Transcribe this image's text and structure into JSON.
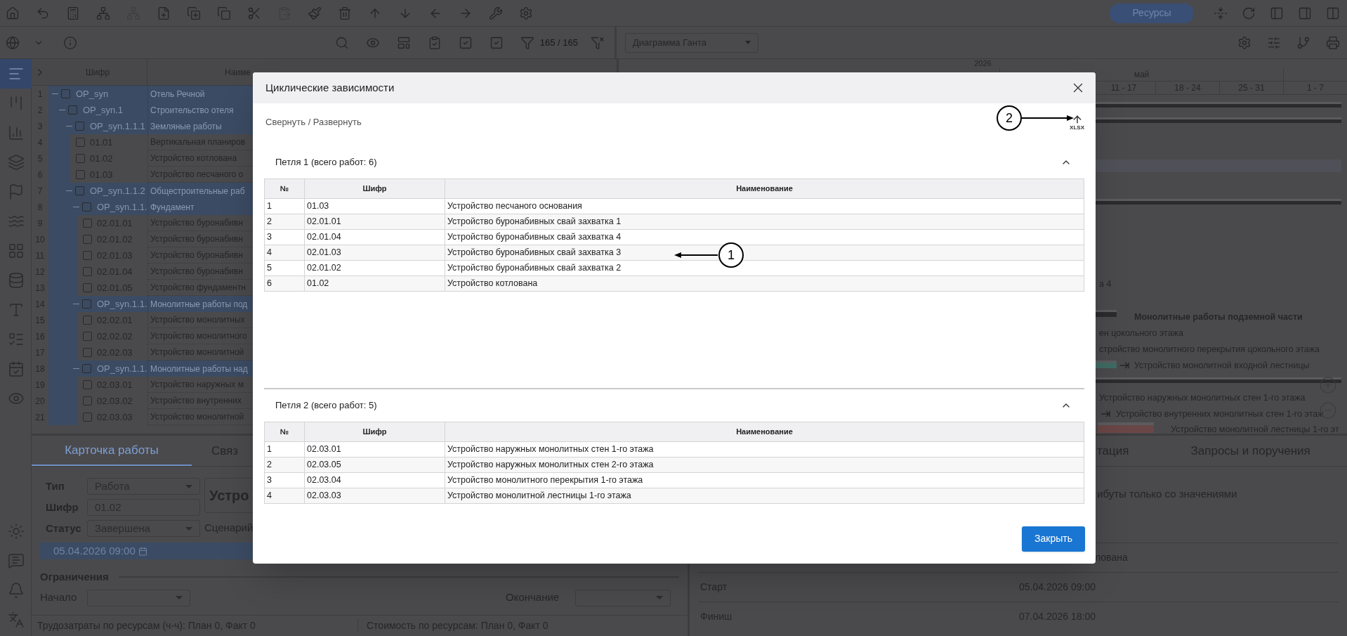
{
  "toolbar": {
    "resource_button": "Ресурсы",
    "filter_count": "165 / 165",
    "view_select": "Диаграмма Ганта"
  },
  "sidebar": {
    "items": [
      {
        "selected": true
      },
      {
        "selected": false
      },
      {
        "selected": false
      },
      {
        "selected": false
      },
      {
        "selected": false
      },
      {
        "selected": false
      },
      {
        "selected": false
      },
      {
        "selected": false
      },
      {
        "selected": false
      },
      {
        "selected": false
      },
      {
        "selected": false
      },
      {
        "selected": false
      },
      {
        "selected": false
      },
      {
        "selected": false
      },
      {
        "selected": false
      },
      {
        "selected": false
      }
    ]
  },
  "tree": {
    "columns": [
      "Шифр",
      "Наиме"
    ],
    "rows": [
      {
        "num": "1",
        "code": "OP_syn",
        "name": "Отель Речной",
        "checked": false,
        "expanded": true,
        "children": [
          {
            "num": "2",
            "code": "OP_syn.1",
            "name": "Строительство отеля",
            "checked": false,
            "expanded": true,
            "children": [
              {
                "num": "3",
                "code": "OP_syn.1.1.1",
                "name": "Земляные работы",
                "checked": false,
                "expanded": true,
                "children": [
                  {
                    "num": "4",
                    "code": "01.01",
                    "name": "Вертикальная планиров",
                    "checked": false
                  },
                  {
                    "num": "5",
                    "code": "01.02",
                    "name": "Устройство котлована",
                    "checked": false
                  },
                  {
                    "num": "6",
                    "code": "01.03",
                    "name": "Устройство песчаного о",
                    "checked": false
                  }
                ]
              },
              {
                "num": "7",
                "code": "OP_syn.1.1.2",
                "name": "Общестроительные раб",
                "checked": false,
                "expanded": true,
                "children": [
                  {
                    "num": "8",
                    "code": "OP_syn.1.1.",
                    "name": "Фундамент",
                    "checked": false,
                    "expanded": true,
                    "children": [
                      {
                        "num": "9",
                        "code": "02.01.01",
                        "name": "Устройство буронабивн",
                        "checked": false
                      },
                      {
                        "num": "10",
                        "code": "02.01.02",
                        "name": "Устройство буронабивн",
                        "checked": false
                      },
                      {
                        "num": "11",
                        "code": "02.01.03",
                        "name": "Устройство буронабивн",
                        "checked": false
                      },
                      {
                        "num": "12",
                        "code": "02.01.04",
                        "name": "Устройство буронабивн",
                        "checked": false
                      },
                      {
                        "num": "13",
                        "code": "02.01.05",
                        "name": "Устройство фундаментн",
                        "checked": false
                      }
                    ]
                  },
                  {
                    "num": "14",
                    "code": "OP_syn.1.1.",
                    "name": "Монолитные работы под",
                    "checked": false,
                    "expanded": true,
                    "children": [
                      {
                        "num": "15",
                        "code": "02.02.01",
                        "name": "Устройство монолитных",
                        "checked": false
                      },
                      {
                        "num": "16",
                        "code": "02.02.02",
                        "name": "Устройство монолитного",
                        "checked": false
                      },
                      {
                        "num": "17",
                        "code": "02.02.03",
                        "name": "Устройство монолитной",
                        "checked": false
                      }
                    ]
                  },
                  {
                    "num": "18",
                    "code": "OP_syn.1.1.",
                    "name": "Монолитные работы над",
                    "checked": false,
                    "expanded": true,
                    "children": [
                      {
                        "num": "19",
                        "code": "02.03.01",
                        "name": "Устройство наружных м",
                        "checked": false
                      },
                      {
                        "num": "20",
                        "code": "02.03.02",
                        "name": "Устройство внутренних",
                        "checked": false
                      },
                      {
                        "num": "21",
                        "code": "02.03.03",
                        "name": "Устройство монолитной",
                        "checked": false
                      }
                    ]
                  }
                ]
              }
            ]
          }
        ]
      }
    ]
  },
  "work_card": {
    "tabs": [
      {
        "label": "Карточка работы",
        "selected": true
      },
      {
        "label": "Связ",
        "selected": false
      }
    ],
    "fields": [
      {
        "label": "Тип",
        "value": "Работа",
        "kind": "select"
      },
      {
        "label": "Шифр",
        "value": "01.02",
        "kind": "text"
      },
      {
        "label": "Статус",
        "value": "Завершена",
        "kind": "select"
      }
    ],
    "title": "Устро",
    "scenario_label": "Сценарий",
    "date": "05.04.2026 09:00",
    "constraints_title": "Ограничения",
    "start_label": "Начало",
    "end_label": "Окончание",
    "labor": "Трудозатраты по ресурсам (ч-ч): План 0, Факт 0",
    "cost": "Стоимость по ресурсам: План 0, Факт 0"
  },
  "gantt": {
    "year": "2026",
    "month": "май",
    "weeks": [
      "11 - 17",
      "18 - 24",
      "25 - 31",
      "1 - 7"
    ],
    "items": [
      {
        "text": "а 4",
        "kind": "label"
      },
      {
        "text": "Монолитные работы подземной части",
        "kind": "summary"
      },
      {
        "text": "ен цокольного этажа",
        "kind": "label"
      },
      {
        "text": "стройство монолитного перекрытия цокольного этажа",
        "kind": "label"
      },
      {
        "text": "Устройство монолитной входной лестницы",
        "kind": "label"
      },
      {
        "text": "Устройство наружных монолитных стен 1-го этажа",
        "kind": "label"
      },
      {
        "text": "Устройство внутренних монолитных стен 1-го этаж",
        "kind": "label"
      },
      {
        "text": "Устройство монолитной лестницы 1-го эт",
        "kind": "label"
      }
    ]
  },
  "details": {
    "tabs": [
      {
        "label": "тация",
        "selected": false
      },
      {
        "label": "Запросы и поручения",
        "selected": false
      }
    ],
    "filter_text": "ибуты только со значениями",
    "rows": [
      {
        "value": "лована"
      },
      {
        "label": "Старт",
        "value": "05.04.2026 09:00"
      },
      {
        "label": "Финиш",
        "value": "07.04.2026 18:00"
      }
    ]
  },
  "dialog": {
    "title": "Циклические зависимости",
    "toggle_link": "Свернуть / Развернуть",
    "export_label": "XLSX",
    "loops": [
      {
        "title": "Петля 1 (всего работ: 6)",
        "expanded": true,
        "columns": [
          "№",
          "Шифр",
          "Наименование"
        ],
        "rows": [
          [
            "1",
            "01.03",
            "Устройство песчаного основания"
          ],
          [
            "2",
            "02.01.01",
            "Устройство буронабивных свай захватка 1"
          ],
          [
            "3",
            "02.01.04",
            "Устройство буронабивных свай захватка 4"
          ],
          [
            "4",
            "02.01.03",
            "Устройство буронабивных свай захватка 3"
          ],
          [
            "5",
            "02.01.02",
            "Устройство буронабивных свай захватка 2"
          ],
          [
            "6",
            "01.02",
            "Устройство котлована"
          ]
        ]
      },
      {
        "title": "Петля 2 (всего работ: 5)",
        "expanded": true,
        "columns": [
          "№",
          "Шифр",
          "Наименование"
        ],
        "rows": [
          [
            "1",
            "02.03.01",
            "Устройство наружных монолитных стен 1-го этажа"
          ],
          [
            "2",
            "02.03.05",
            "Устройство наружных монолитных стен 2-го этажа"
          ],
          [
            "3",
            "02.03.04",
            "Устройство монолитного перекрытия 1-го этажа"
          ],
          [
            "4",
            "02.03.03",
            "Устройство монолитной лестницы 1-го этажа"
          ]
        ]
      }
    ],
    "close_button": "Закрыть",
    "callouts": [
      {
        "label": "1"
      },
      {
        "label": "2"
      }
    ]
  }
}
